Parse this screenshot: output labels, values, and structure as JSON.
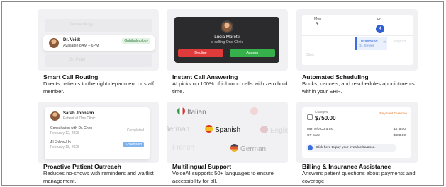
{
  "cards": [
    {
      "title": "Smart Call Routing",
      "desc": "Directs patients to the right department or staff member.",
      "thumb": {
        "doctor": "Dr. Veidt",
        "available": "Available 8AM – 6PM",
        "specialty": "Ophthalmology",
        "ghost": "Dr. Patel",
        "ghost2": "Dermatology"
      }
    },
    {
      "title": "Instant Call Answering",
      "desc": "AI picks up 100% of inbound calls with zero hold time.",
      "thumb": {
        "caller": "Lucia Moretti",
        "status": "is calling One Clinic",
        "decline": "Decline",
        "answer": "Answer"
      }
    },
    {
      "title": "Automated Scheduling",
      "desc": "Books, cancels, and reschedules appointments within your EHR.",
      "thumb": {
        "day1": "Mon",
        "num1": "3",
        "day2": "Fri",
        "num2": "4",
        "appt_title": "Ultrasound",
        "appt_sub": "Dr. Sewell",
        "ghost": "Nephro",
        "ghost2": "Clinic"
      }
    },
    {
      "title": "Proactive Patient Outreach",
      "desc": "Reduces no-shows with reminders and waitlist management.",
      "thumb": {
        "name": "Sarah Johnson",
        "sub": "Patient at One Clinic",
        "row1": "Consultation with Dr. Chen",
        "row1_date": "February 12, 2025",
        "row1_tag": "Completed",
        "row2": "AI Follow-Up",
        "row2_date": "February 18, 2025",
        "row2_tag": "Scheduled"
      }
    },
    {
      "title": "Multilingual Support",
      "desc": "VoiceAI supports 50+ languages to ensure accessibility for all.",
      "thumb": {
        "langs": [
          "Italian",
          "German",
          "Spanish",
          "English",
          "French",
          "German"
        ]
      }
    },
    {
      "title": "Billing & Insurance Assistance",
      "desc": "Answers patient questions about payments and coverage.",
      "thumb": {
        "label": "Charges",
        "amount": "$750.00",
        "status": "Payment Overdue",
        "row1": "MRI w/o Contrast",
        "row1_amt": "$375.00",
        "row2": "CT Scan",
        "row2_amt": "$800.00",
        "pay": "Click here to pay your overdue balance."
      }
    }
  ]
}
